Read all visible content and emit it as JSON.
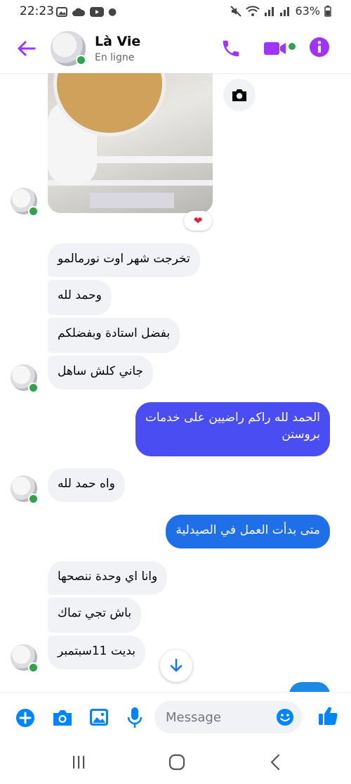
{
  "status_bar": {
    "time": "22:23",
    "battery": "63%"
  },
  "header": {
    "name": "Là Vie",
    "status": "En ligne"
  },
  "colors": {
    "accent": "#a033ff",
    "online": "#31a24c",
    "bubble_in": "#f0f2f5",
    "bubble_out_1": "#4a4ef2",
    "bubble_out_2": "#1f6fe8",
    "composer_blue": "#0084ff"
  },
  "messages": [
    {
      "from": "them",
      "text": "تخرجت شهر اوت نورمالمو"
    },
    {
      "from": "them",
      "text": "وحمد لله"
    },
    {
      "from": "them",
      "text": "بفضل استادة وبفضلكم"
    },
    {
      "from": "them",
      "text": "جاني كلش ساهل"
    },
    {
      "from": "me",
      "lines": [
        "الحمد لله راكم راضيين على خدمات",
        "بروستن"
      ]
    },
    {
      "from": "them",
      "text": "واه حمد لله"
    },
    {
      "from": "me",
      "text": "متى بدأت العمل في الصيدلية"
    },
    {
      "from": "them",
      "text": "وانا اي وحدة ننصحها"
    },
    {
      "from": "them",
      "text": "باش تجي تماك"
    },
    {
      "from": "them",
      "text": "بديت 11سبتمبر"
    }
  ],
  "photo_reaction": "❤",
  "composer": {
    "placeholder": "Message"
  },
  "icons": [
    "back-arrow-icon",
    "phone-icon",
    "video-icon",
    "info-icon",
    "camera-icon",
    "plus-icon",
    "gallery-icon",
    "mic-icon",
    "emoji-icon",
    "like-icon",
    "scroll-down-icon"
  ]
}
